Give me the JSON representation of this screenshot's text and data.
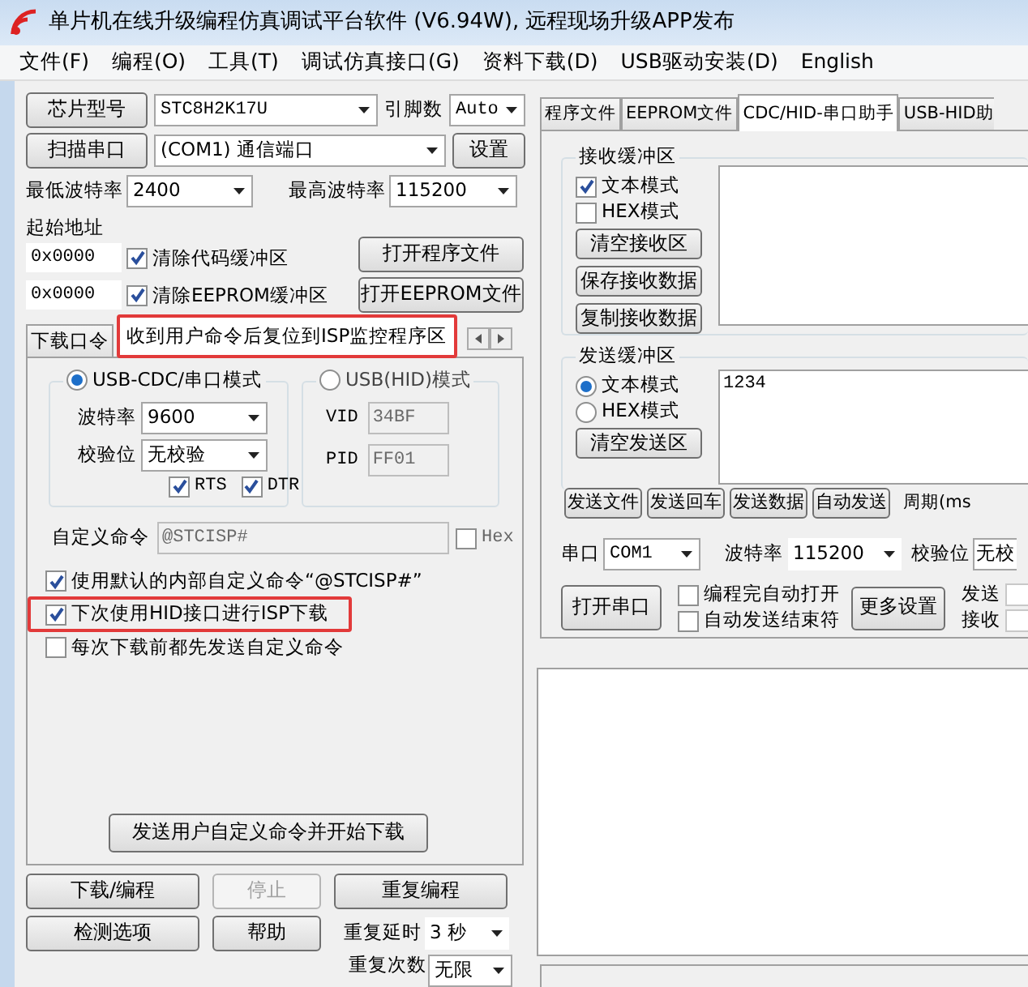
{
  "window": {
    "title": "单片机在线升级编程仿真调试平台软件 (V6.94W), 远程现场升级APP发布"
  },
  "menu": [
    "文件(F)",
    "编程(O)",
    "工具(T)",
    "调试仿真接口(G)",
    "资料下载(D)",
    "USB驱动安装(D)",
    "English"
  ],
  "left": {
    "chip": {
      "button": "芯片型号",
      "value": "STC8H2K17U",
      "pins_label": "引脚数",
      "pins": "Auto"
    },
    "port": {
      "button": "扫描串口",
      "value": "(COM1) 通信端口",
      "settings": "设置"
    },
    "baud": {
      "min_label": "最低波特率",
      "min": "2400",
      "max_label": "最高波特率",
      "max": "115200"
    },
    "start_address_label": "起始地址",
    "address_rows": [
      {
        "address": "0x0000",
        "label": "清除代码缓冲区",
        "checked": true,
        "button": "打开程序文件"
      },
      {
        "address": "0x0000",
        "label": "清除EEPROM缓冲区",
        "checked": true,
        "button": "打开EEPROM文件"
      }
    ],
    "tabs": [
      {
        "label": "下载口令",
        "selected": false,
        "highlighted": false
      },
      {
        "label": "收到用户命令后复位到ISP监控程序区",
        "selected": true,
        "highlighted": true
      }
    ],
    "cdc_mode": {
      "label": "USB-CDC/串口模式",
      "selected": true,
      "baud_label": "波特率",
      "baud": "9600",
      "parity_label": "校验位",
      "parity": "无校验",
      "rts": {
        "label": "RTS",
        "checked": true
      },
      "dtr": {
        "label": "DTR",
        "checked": true
      }
    },
    "hid_mode": {
      "label": "USB(HID)模式",
      "selected": false,
      "vid_label": "VID",
      "vid": "34BF",
      "pid_label": "PID",
      "pid": "FF01"
    },
    "custom_command": {
      "label": "自定义命令",
      "value": "@STCISP#",
      "hex": {
        "label": "Hex",
        "checked": false
      }
    },
    "options": [
      {
        "label": "使用默认的内部自定义命令“@STCISP#”",
        "checked": true,
        "highlighted": false
      },
      {
        "label": "下次使用HID接口进行ISP下载",
        "checked": true,
        "highlighted": true
      },
      {
        "label": "每次下载前都先发送自定义命令",
        "checked": false,
        "highlighted": false
      }
    ],
    "send_button": "发送用户自定义命令并开始下载",
    "actions": [
      {
        "label": "下载/编程",
        "disabled": false
      },
      {
        "label": "停止",
        "disabled": true
      },
      {
        "label": "重复编程",
        "disabled": false
      },
      {
        "label": "检测选项",
        "disabled": false
      },
      {
        "label": "帮助",
        "disabled": false
      }
    ],
    "repeat_delay": {
      "label": "重复延时",
      "value": "3 秒"
    },
    "repeat_count": {
      "label": "重复次数",
      "value": "无限"
    }
  },
  "right": {
    "tabs": [
      {
        "label": "程序文件",
        "selected": false
      },
      {
        "label": "EEPROM文件",
        "selected": false
      },
      {
        "label": "CDC/HID-串口助手",
        "selected": true
      },
      {
        "label": "USB-HID助",
        "selected": false
      }
    ],
    "receive": {
      "title": "接收缓冲区",
      "modes": [
        {
          "label": "文本模式",
          "checked": true
        },
        {
          "label": "HEX模式",
          "checked": false
        }
      ],
      "buttons": [
        "清空接收区",
        "保存接收数据",
        "复制接收数据"
      ]
    },
    "send": {
      "title": "发送缓冲区",
      "modes": [
        {
          "label": "文本模式",
          "selected": true
        },
        {
          "label": "HEX模式",
          "selected": false
        }
      ],
      "button": "清空发送区",
      "value": "1234"
    },
    "send_buttons": [
      "发送文件",
      "发送回车",
      "发送数据",
      "自动发送"
    ],
    "period_label": "周期(ms",
    "serial": {
      "port_label": "串口",
      "port": "COM1",
      "baud_label": "波特率",
      "baud": "115200",
      "parity_label": "校验位",
      "parity": "无校"
    },
    "open_button": "打开串口",
    "auto_options": [
      {
        "label": "编程完自动打开",
        "checked": false
      },
      {
        "label": "自动发送结束符",
        "checked": false
      }
    ],
    "more_button": "更多设置",
    "counters": [
      "发送",
      "接收"
    ]
  }
}
